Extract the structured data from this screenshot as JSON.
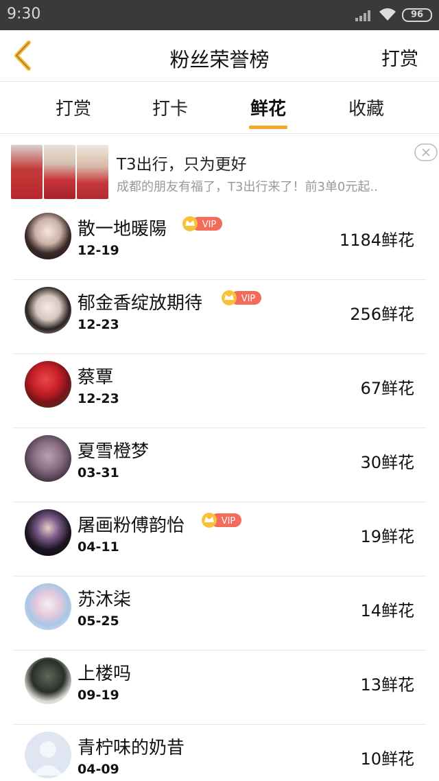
{
  "status_bar": {
    "time": "9:30",
    "battery": "96"
  },
  "header": {
    "title": "粉丝荣誉榜",
    "action": "打赏"
  },
  "tabs": [
    {
      "label": "打赏"
    },
    {
      "label": "打卡"
    },
    {
      "label": "鲜花"
    },
    {
      "label": "收藏"
    }
  ],
  "active_tab": "鲜花",
  "ad": {
    "title": "T3出行，只为更好",
    "description": "成都的朋友有福了，T3出行来了！前3单0元起.."
  },
  "list": [
    {
      "name": "散一地暖陽",
      "date": "12-19",
      "count": "1184鲜花",
      "vip": "VIP"
    },
    {
      "name": "郁金香绽放期待",
      "date": "12-23",
      "count": "256鲜花",
      "vip": "VIP"
    },
    {
      "name": "蔡覃",
      "date": "12-23",
      "count": "67鲜花"
    },
    {
      "name": "夏雪橙梦",
      "date": "03-31",
      "count": "30鲜花"
    },
    {
      "name": "屠画粉傅韵怡",
      "date": "04-11",
      "count": "19鲜花",
      "vip": "VIP"
    },
    {
      "name": "苏沐柒",
      "date": "05-25",
      "count": "14鲜花"
    },
    {
      "name": "上楼吗",
      "date": "09-19",
      "count": "13鲜花"
    },
    {
      "name": "青柠味的奶昔",
      "date": "04-09",
      "count": "10鲜花"
    }
  ],
  "colors": {
    "accent": "#f5a623",
    "vip_badge": "#f26b5b",
    "status_bar": "#3a3a3a"
  }
}
